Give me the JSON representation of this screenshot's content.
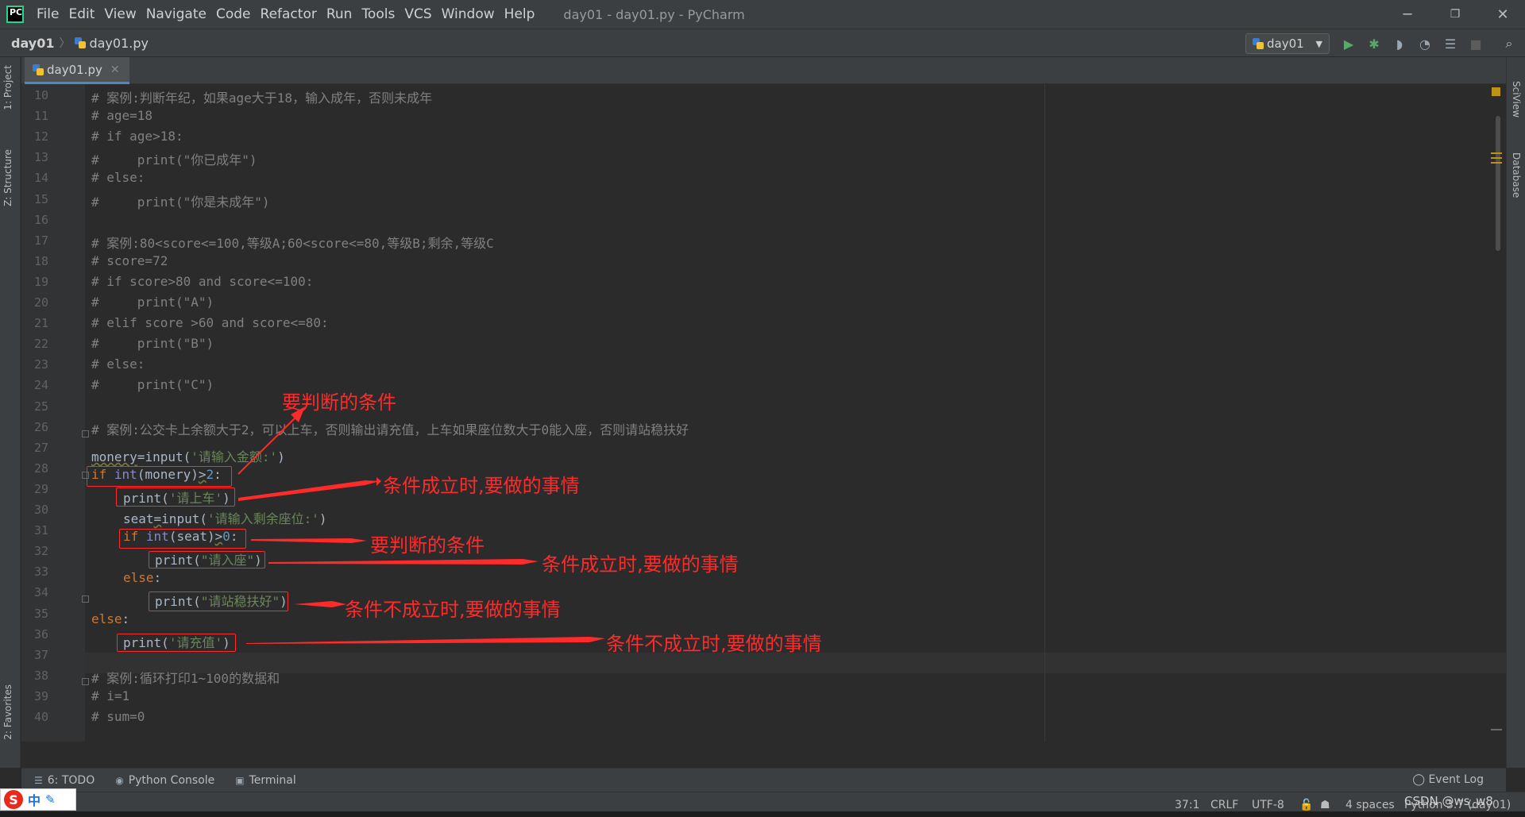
{
  "window": {
    "title": "day01 - day01.py - PyCharm",
    "logo_text": "PC",
    "minimize": "─",
    "restore": "❐",
    "close": "✕"
  },
  "menu": [
    "File",
    "Edit",
    "View",
    "Navigate",
    "Code",
    "Refactor",
    "Run",
    "Tools",
    "VCS",
    "Window",
    "Help"
  ],
  "breadcrumb": {
    "project": "day01",
    "separator": "〉",
    "file": "day01.py"
  },
  "run_config": {
    "label": "day01"
  },
  "toolbar_icons": [
    "run-icon",
    "debug-icon",
    "coverage-icon",
    "profile-icon",
    "concurrency-icon",
    "stop-icon",
    "search-icon"
  ],
  "left_tabs": {
    "project": "1: Project",
    "structure": "Z: Structure",
    "favorites": "2: Favorites"
  },
  "right_tabs": {
    "sciview": "SciView",
    "database": "Database"
  },
  "editor_tab": {
    "label": "day01.py",
    "close": "✕"
  },
  "code_lines": [
    {
      "no": "10",
      "text": "# 案例:判断年纪，如果age大于18，输入成年，否则未成年"
    },
    {
      "no": "11",
      "text": "# age=18"
    },
    {
      "no": "12",
      "text": "# if age>18:"
    },
    {
      "no": "13",
      "text": "#     print(\"你已成年\")"
    },
    {
      "no": "14",
      "text": "# else:"
    },
    {
      "no": "15",
      "text": "#     print(\"你是未成年\")"
    },
    {
      "no": "16",
      "text": ""
    },
    {
      "no": "17",
      "text": "# 案例:80<score<=100,等级A;60<score<=80,等级B;剩余,等级C"
    },
    {
      "no": "18",
      "text": "# score=72"
    },
    {
      "no": "19",
      "text": "# if score>80 and score<=100:"
    },
    {
      "no": "20",
      "text": "#     print(\"A\")"
    },
    {
      "no": "21",
      "text": "# elif score >60 and score<=80:"
    },
    {
      "no": "22",
      "text": "#     print(\"B\")"
    },
    {
      "no": "23",
      "text": "# else:"
    },
    {
      "no": "24",
      "text": "#     print(\"C\")"
    },
    {
      "no": "25",
      "text": ""
    },
    {
      "no": "26",
      "text": "# 案例:公交卡上余额大于2，可以上车，否则输出请充值，上车如果座位数大于0能入座，否则请站稳扶好"
    },
    {
      "no": "27",
      "text": ""
    },
    {
      "no": "28",
      "text": ""
    },
    {
      "no": "29",
      "text": ""
    },
    {
      "no": "30",
      "text": ""
    },
    {
      "no": "31",
      "text": ""
    },
    {
      "no": "32",
      "text": ""
    },
    {
      "no": "33",
      "text": ""
    },
    {
      "no": "34",
      "text": ""
    },
    {
      "no": "35",
      "text": ""
    },
    {
      "no": "36",
      "text": ""
    },
    {
      "no": "37",
      "text": ""
    },
    {
      "no": "38",
      "text": "# 案例:循环打印1~100的数据和"
    },
    {
      "no": "39",
      "text": "# i=1"
    },
    {
      "no": "40",
      "text": "# sum=0"
    }
  ],
  "code_tokens": {
    "l27_var": "monery",
    "l27_eq": "=",
    "l27_fn": "input",
    "l27_str": "'请输入金额:'",
    "l27_close": ")",
    "l28_if": "if ",
    "l28_int": "int",
    "l28_mid": "(monery)",
    "l28_op": ">",
    "l28_num": "2",
    "l28_colon": ":",
    "l29_fn": "print",
    "l29_str": "'请上车'",
    "l30_var": "seat",
    "l30_eq": "=",
    "l30_fn": "input",
    "l30_str": "'请输入剩余座位:'",
    "l31_if": "if ",
    "l31_int": "int",
    "l31_mid": "(seat)",
    "l31_op": ">",
    "l31_num": "0",
    "l32_fn": "print",
    "l32_str": "\"请入座\"",
    "l33_else": "else",
    "l34_fn": "print",
    "l34_str": "\"请站稳扶好\"",
    "l35_else": "else",
    "l36_fn": "print",
    "l36_str": "'请充值'",
    "open": "(",
    "close": ")",
    "colon": ":"
  },
  "annotations": {
    "a1": "要判断的条件",
    "a2": "条件成立时,要做的事情",
    "a3": "要判断的条件",
    "a4": "条件成立时,要做的事情",
    "a5": "条件不成立时,要做的事情",
    "a6": "条件不成立时,要做的事情"
  },
  "bottom_tools": {
    "todo": "6: TODO",
    "console": "Python Console",
    "terminal": "Terminal",
    "event_log": "Event Log"
  },
  "status": {
    "position": "37:1",
    "line_sep": "CRLF",
    "encoding": "UTF-8",
    "indent": "4 spaces",
    "interpreter": "Python 3.7 (day01)",
    "watermark": "CSDN @ws_w8"
  },
  "ime": {
    "logo": "S",
    "lang": "中",
    "pen": "✎"
  },
  "colors": {
    "accent": "#4a88c7",
    "annotation": "#ff2a2a",
    "keyword": "#cc7832",
    "string": "#6a8759",
    "number": "#6897bb"
  }
}
